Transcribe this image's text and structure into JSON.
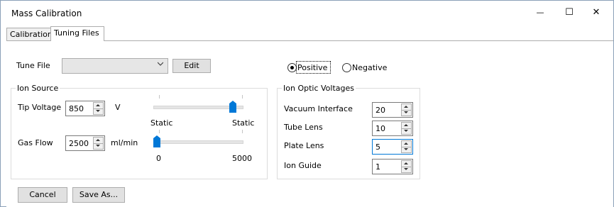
{
  "window": {
    "title": "Mass Calibration",
    "controls": {
      "minimize": "—",
      "maximize": "☐",
      "close": "✕"
    }
  },
  "tabs": [
    {
      "label": "Calibration",
      "active": false
    },
    {
      "label": "Tuning Files",
      "active": true
    }
  ],
  "tune_file": {
    "label": "Tune File",
    "selected": "",
    "edit_label": "Edit"
  },
  "polarity": {
    "positive_label": "Positive",
    "negative_label": "Negative",
    "selected": "Positive"
  },
  "ion_source": {
    "title": "Ion Source",
    "tip_voltage": {
      "label": "Tip Voltage",
      "value": "850",
      "unit": "V",
      "slider_left_label": "Static",
      "slider_right_label": "Static",
      "slider_fraction": 0.93
    },
    "gas_flow": {
      "label": "Gas Flow",
      "value": "2500",
      "unit": "ml/min",
      "slider_min_label": "0",
      "slider_max_label": "5000",
      "slider_fraction": 0.0
    }
  },
  "ion_optic": {
    "title": "Ion Optic Voltages",
    "rows": [
      {
        "label": "Vacuum Interface",
        "value": "20"
      },
      {
        "label": "Tube Lens",
        "value": "10"
      },
      {
        "label": "Plate Lens",
        "value": "5"
      },
      {
        "label": "Ion Guide",
        "value": "1"
      }
    ]
  },
  "footer": {
    "cancel_label": "Cancel",
    "save_as_label": "Save As..."
  },
  "colors": {
    "accent": "#0078d7",
    "border": "#adadad",
    "button": "#e1e1e1"
  }
}
